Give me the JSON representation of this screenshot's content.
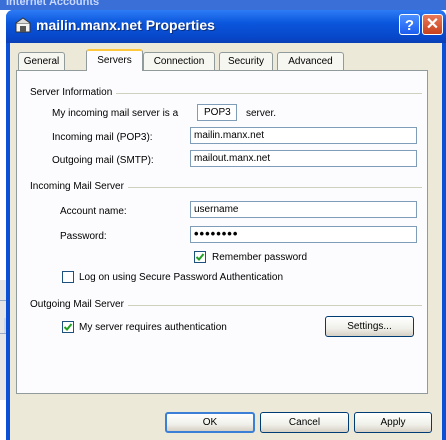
{
  "background_window": {
    "title": "Internet Accounts"
  },
  "dialog": {
    "title": "mailin.manx.net Properties",
    "help_glyph": "?",
    "close_glyph": "✕",
    "tabs": [
      {
        "label": "General"
      },
      {
        "label": "Servers"
      },
      {
        "label": "Connection"
      },
      {
        "label": "Security"
      },
      {
        "label": "Advanced"
      }
    ],
    "active_tab": "Servers"
  },
  "server_info": {
    "heading": "Server Information",
    "incoming_prefix": "My incoming mail server is a",
    "server_type": "POP3",
    "incoming_suffix": "server.",
    "incoming_label": "Incoming mail (POP3):",
    "incoming_value": "mailin.manx.net",
    "outgoing_label": "Outgoing mail (SMTP):",
    "outgoing_value": "mailout.manx.net"
  },
  "incoming_server": {
    "heading": "Incoming Mail Server",
    "account_label": "Account name:",
    "account_value": "username",
    "password_label": "Password:",
    "password_value": "••••••••",
    "remember_label": "Remember password",
    "remember_checked": true,
    "spa_label": "Log on using Secure Password Authentication",
    "spa_checked": false
  },
  "outgoing_server": {
    "heading": "Outgoing Mail Server",
    "auth_label": "My server requires authentication",
    "auth_checked": true,
    "settings_button": "Settings..."
  },
  "footer": {
    "ok": "OK",
    "cancel": "Cancel",
    "apply": "Apply"
  },
  "colors": {
    "title_bar": "#0a56dc",
    "dialog_face": "#ece9d8",
    "active_tab_accent": "#ffc83c",
    "close_button": "#c8401c"
  }
}
